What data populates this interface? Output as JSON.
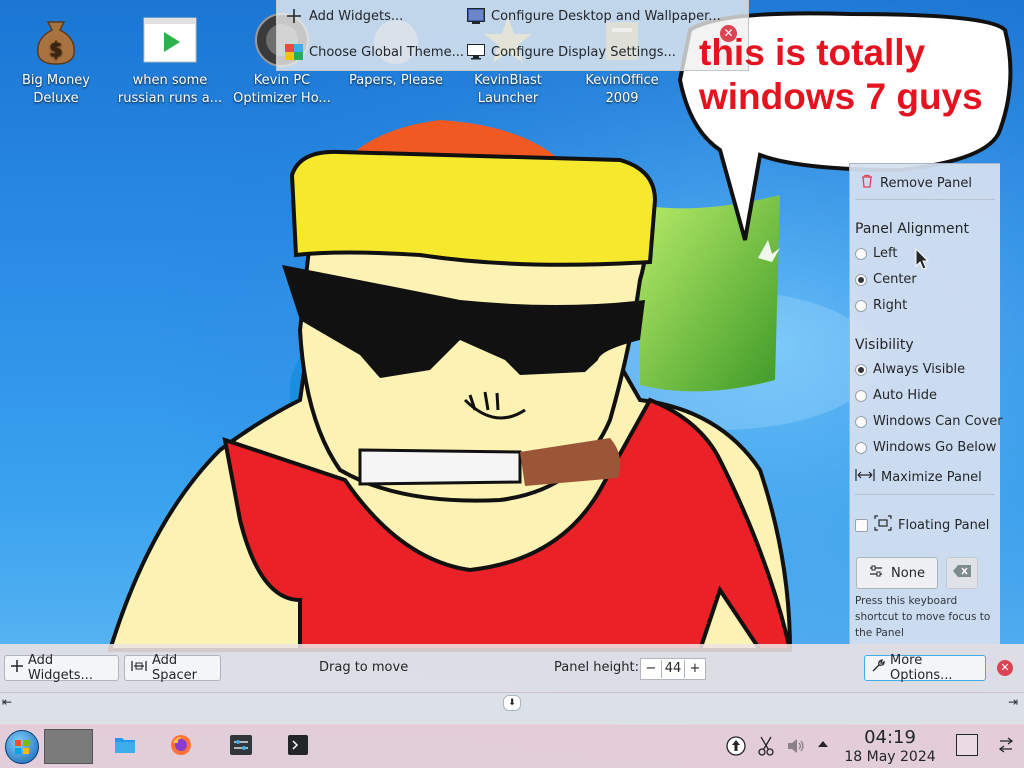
{
  "desktop": {
    "icons": [
      {
        "label_line1": "Big Money",
        "label_line2": "Deluxe",
        "icon": "money-bag-icon"
      },
      {
        "label_line1": "when some",
        "label_line2": "russian runs a...",
        "icon": "video-player-icon"
      },
      {
        "label_line1": "Kevin PC",
        "label_line2": "Optimizer Ho...",
        "icon": "optimizer-icon"
      },
      {
        "label_line1": "Papers, Please",
        "label_line2": "",
        "icon": "game-icon"
      },
      {
        "label_line1": "KevinBlast",
        "label_line2": "Launcher",
        "icon": "launcher-icon"
      },
      {
        "label_line1": "KevinOffice",
        "label_line2": "2009",
        "icon": "office-icon"
      }
    ]
  },
  "toolbox": {
    "add_widgets": "Add Widgets...",
    "configure_desktop": "Configure Desktop and Wallpaper...",
    "choose_theme": "Choose Global Theme...",
    "configure_display": "Configure Display Settings..."
  },
  "bubble": {
    "line1": "this is totally",
    "line2": "windows 7 guys"
  },
  "panel_options": {
    "remove_panel": "Remove Panel",
    "alignment_title": "Panel Alignment",
    "alignment": [
      {
        "label": "Left",
        "selected": false
      },
      {
        "label": "Center",
        "selected": true
      },
      {
        "label": "Right",
        "selected": false
      }
    ],
    "visibility_title": "Visibility",
    "visibility": [
      {
        "label": "Always Visible",
        "selected": true
      },
      {
        "label": "Auto Hide",
        "selected": false
      },
      {
        "label": "Windows Can Cover",
        "selected": false
      },
      {
        "label": "Windows Go Below",
        "selected": false
      }
    ],
    "maximize_panel": "Maximize Panel",
    "floating_panel": "Floating Panel",
    "shortcut_label": "None",
    "shortcut_hint": "Press this keyboard shortcut to move focus to the Panel"
  },
  "edit_bar": {
    "add_widgets": "Add Widgets...",
    "add_spacer": "Add Spacer",
    "drag_hint": "Drag to move",
    "height_label": "Panel height:",
    "height_value": "44",
    "more_options": "More Options..."
  },
  "taskbar": {
    "time": "04:19",
    "date": "18 May 2024"
  },
  "colors": {
    "accent": "#3daee9",
    "close_red": "#da4453",
    "bubble_text": "#e3131f"
  }
}
